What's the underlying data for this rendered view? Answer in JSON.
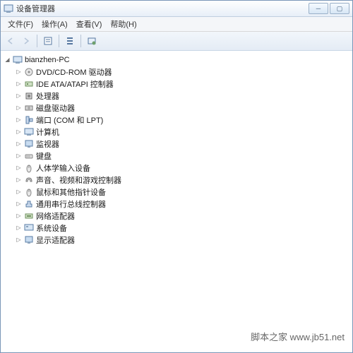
{
  "window": {
    "title": "设备管理器"
  },
  "menu": {
    "file": "文件(F)",
    "action": "操作(A)",
    "view": "查看(V)",
    "help": "帮助(H)"
  },
  "tree": {
    "root": "bianzhen-PC",
    "items": [
      "DVD/CD-ROM 驱动器",
      "IDE ATA/ATAPI 控制器",
      "处理器",
      "磁盘驱动器",
      "端口 (COM 和 LPT)",
      "计算机",
      "监视器",
      "键盘",
      "人体学输入设备",
      "声音、视频和游戏控制器",
      "鼠标和其他指针设备",
      "通用串行总线控制器",
      "网络适配器",
      "系统设备",
      "显示适配器"
    ]
  },
  "watermark": "脚本之家  www.jb51.net"
}
